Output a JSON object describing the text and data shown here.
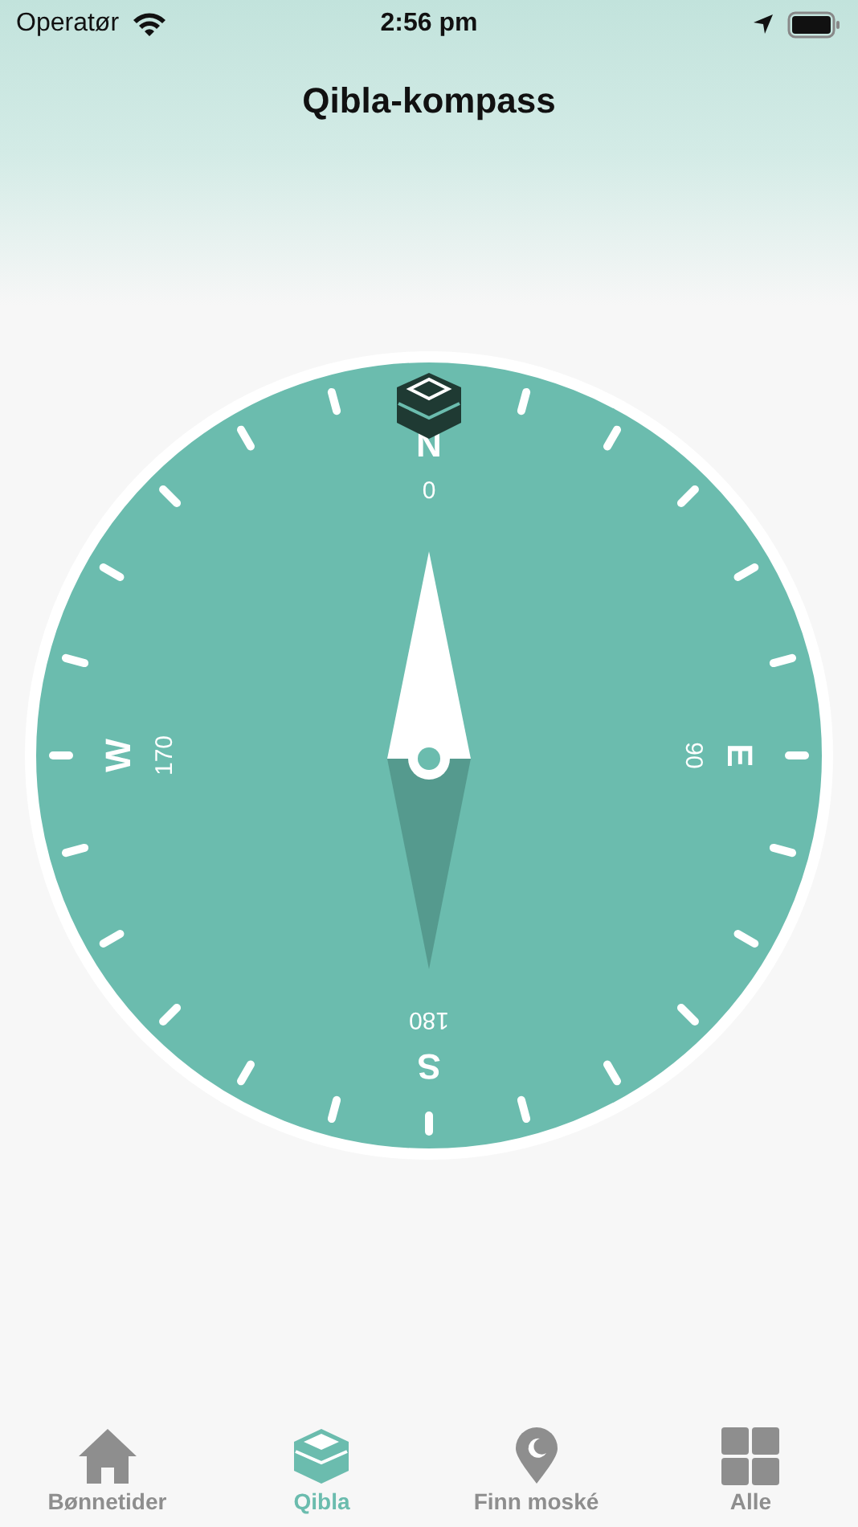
{
  "status_bar": {
    "carrier": "Operatør",
    "time": "2:56 pm"
  },
  "title": "Qibla-kompass",
  "compass": {
    "labels": [
      {
        "letter": "N",
        "degree": "0"
      },
      {
        "letter": "E",
        "degree": "90"
      },
      {
        "letter": "S",
        "degree": "180"
      },
      {
        "letter": "W",
        "degree": "170"
      }
    ]
  },
  "tabs": [
    {
      "label": "Bønnetider",
      "selected": false
    },
    {
      "label": "Qibla",
      "selected": true
    },
    {
      "label": "Finn moské",
      "selected": false
    },
    {
      "label": "Alle",
      "selected": false
    }
  ]
}
